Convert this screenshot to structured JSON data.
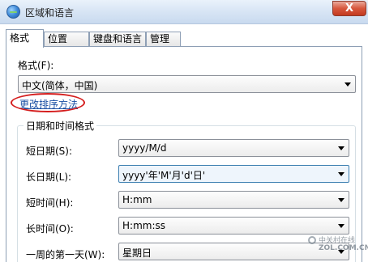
{
  "window": {
    "title": "区域和语言",
    "close_symbol": "X"
  },
  "tabs": [
    {
      "label": "格式",
      "active": true
    },
    {
      "label": "位置",
      "active": false
    },
    {
      "label": "键盘和语言",
      "active": false
    },
    {
      "label": "管理",
      "active": false
    }
  ],
  "format": {
    "label": "格式(F):",
    "selected": "中文(简体，中国)"
  },
  "sort_link": "更改排序方法",
  "datetime_group": {
    "title": "日期和时间格式",
    "fields": [
      {
        "label": "短日期(S):",
        "value": "yyyy/M/d"
      },
      {
        "label": "长日期(L):",
        "value": "yyyy'年'M'月'd'日'"
      },
      {
        "label": "短时间(H):",
        "value": "H:mm"
      },
      {
        "label": "长时间(O):",
        "value": "H:mm:ss"
      },
      {
        "label": "一周的第一天(W):",
        "value": "星期日"
      }
    ]
  },
  "watermark": {
    "cn": "中关村在线",
    "en": "ZOL.COM.CN"
  },
  "colors": {
    "annotation_circle": "#d51e1e",
    "link": "#1a4fa3",
    "close_button": "#c33a1f"
  }
}
